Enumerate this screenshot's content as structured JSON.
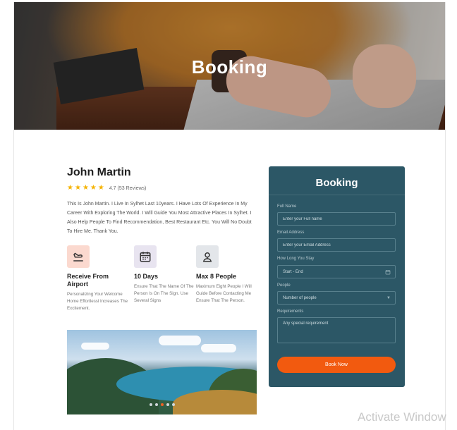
{
  "hero": {
    "title": "Booking"
  },
  "profile": {
    "name": "John Martin",
    "rating_text": "4.7 (53 Reviews)",
    "stars": 5,
    "bio": "This Is John Martin. I Live In Sylhet Last 10years. I Have Lots Of Experience In My Career With Exploring The World. I Will Guide You Most Attractive Places In Sylhet. I Also Help People To Find Recommendation, Best Restaurant Etc. You Will No Doubt To Hire Me. Thank You."
  },
  "features": [
    {
      "icon": "plane-landing-icon",
      "title": "Receive From Airport",
      "desc": "Personalizing Your Welcome Home Effortlessl Increases The Excitement.",
      "color": "#fbd9cf"
    },
    {
      "icon": "calendar-icon",
      "title": "10 Days",
      "desc": "Ensure That The Name Of The Person Is On The Sign. Use Several Signs",
      "color": "#e8e4f0"
    },
    {
      "icon": "person-icon",
      "title": "Max 8 People",
      "desc": "Maximum Eight People I Will Guide Before Contacting Me Ensure That The Person.",
      "color": "#e3e6ea"
    }
  ],
  "gallery": {
    "dots": 5,
    "active_dot": 2
  },
  "booking_form": {
    "title": "Booking",
    "full_name_label": "Full Name",
    "full_name_placeholder": "Enter your Full name",
    "email_label": "Email Address",
    "email_placeholder": "Enter your Email Address",
    "stay_label": "How Long You Stay",
    "stay_placeholder": "Start - End",
    "people_label": "People",
    "people_value": "Number of people",
    "requirements_label": "Requirements",
    "requirements_placeholder": "Any special requirement",
    "submit_label": "Book Now"
  },
  "watermark": "Activate Window",
  "colors": {
    "accent": "#f25a0f",
    "form_bg": "#2c5766",
    "star": "#f5b301"
  }
}
